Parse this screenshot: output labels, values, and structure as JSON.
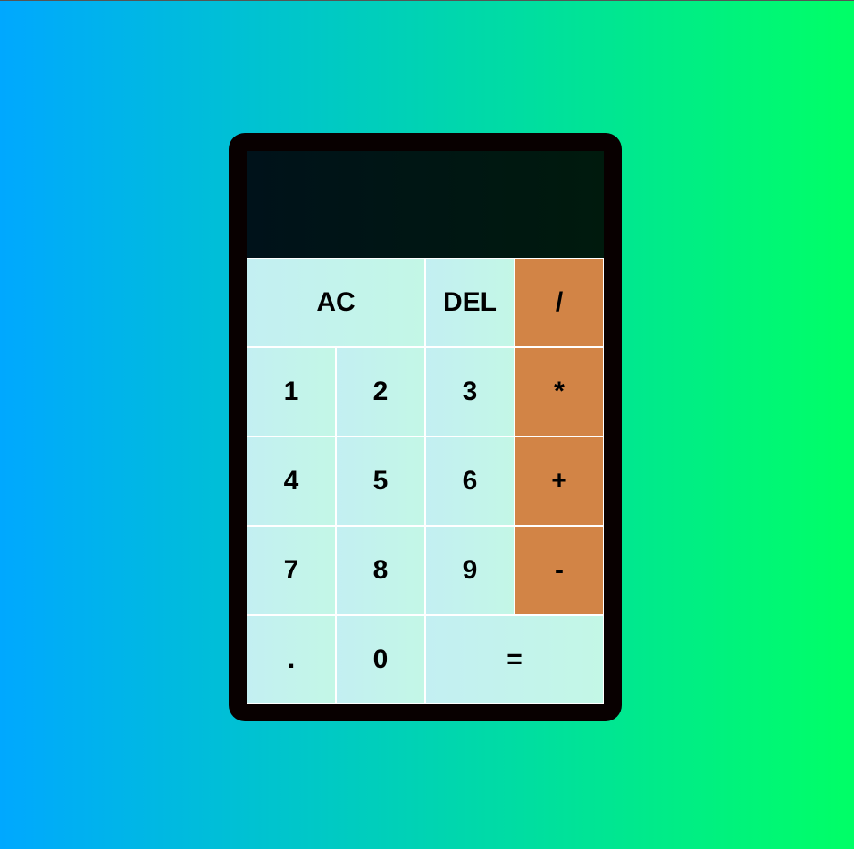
{
  "display": {
    "previous_operand": "",
    "current_operand": ""
  },
  "keys": {
    "all_clear": "AC",
    "delete": "DEL",
    "divide": "/",
    "one": "1",
    "two": "2",
    "three": "3",
    "multiply": "*",
    "four": "4",
    "five": "5",
    "six": "6",
    "add": "+",
    "seven": "7",
    "eight": "8",
    "nine": "9",
    "subtract": "-",
    "decimal": ".",
    "zero": "0",
    "equals": "="
  },
  "colors": {
    "background_start": "#00a8ff",
    "background_end": "#00ff66",
    "frame": "#080000",
    "display": "#00121a",
    "key": "#c3eff2",
    "operator_key": "#d28446"
  }
}
